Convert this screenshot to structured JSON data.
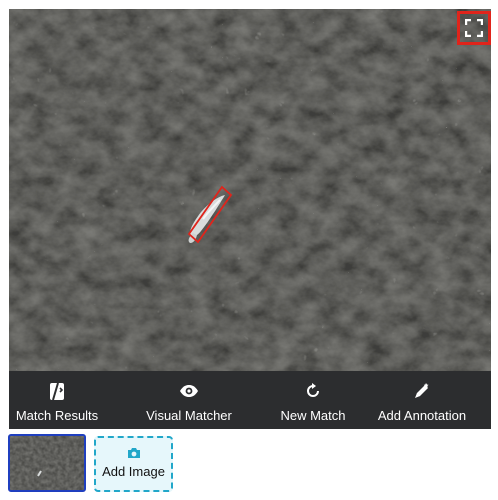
{
  "toolbar": {
    "match_results": "Match Results",
    "visual_matcher": "Visual Matcher",
    "new_match": "New Match",
    "add_annotation": "Add Annotation"
  },
  "gallery": {
    "add_image_label": "Add Image"
  },
  "colors": {
    "annotation_box": "#e0241b",
    "toolbar_bg": "#2c2d2f",
    "selected_thumb_border": "#1f3fbf",
    "add_image_border": "#21a7c9"
  },
  "icons": {
    "fullscreen": "fullscreen-icon",
    "match_results": "match-results-icon",
    "visual_matcher": "eye-icon",
    "new_match": "refresh-icon",
    "add_annotation": "pen-icon",
    "add_image": "camera-icon"
  }
}
